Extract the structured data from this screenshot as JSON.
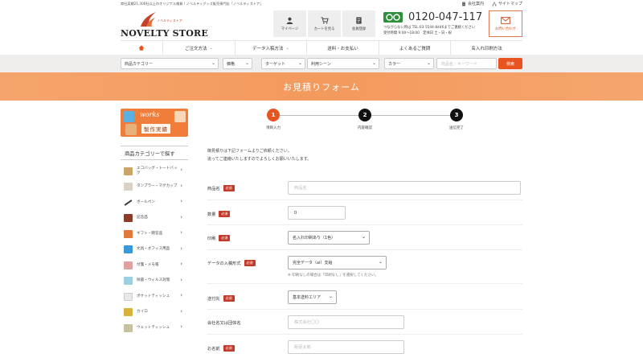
{
  "topbar": {
    "note": "商社実績21,300社以上のオリジナル雑貨 / ノベルティグッズ販売専門店「ノベルティストア」",
    "links": [
      {
        "label": "会社案内",
        "icon": "building-icon"
      },
      {
        "label": "サイトマップ",
        "icon": "sitemap-icon"
      }
    ]
  },
  "logo": {
    "name": "NOVELTY STORE",
    "tagline": "ノベルティストア"
  },
  "header_buttons": [
    {
      "label": "マイページ",
      "icon": "user-icon"
    },
    {
      "label": "カートを見る",
      "icon": "cart-icon"
    },
    {
      "label": "会員登録",
      "icon": "register-icon"
    }
  ],
  "phone": {
    "number": "0120-047-117",
    "sub1": "つながらない時は TEL:03-5544-8446までご連絡ください",
    "sub2": "受付時間 9:00～18:00　定休日 土・日・祝"
  },
  "contact": {
    "label": "お問い合わせ",
    "icon": "mail-icon"
  },
  "nav": [
    {
      "label": "",
      "icon": "home-icon"
    },
    {
      "label": "ご注文方法",
      "chevron": true
    },
    {
      "label": "データ入稿方法",
      "chevron": true
    },
    {
      "label": "送料・お支払い",
      "chevron": false
    },
    {
      "label": "よくあるご質問",
      "chevron": false
    },
    {
      "label": "名入れ印刷方法",
      "chevron": false
    }
  ],
  "filters": {
    "category": "商品カテゴリー",
    "price": "価格",
    "target": "ターゲット",
    "scene": "利用シーン",
    "color": "カラー",
    "keyword_placeholder": "商品名・キーワード",
    "search_label": "検索"
  },
  "banner": {
    "title": "お見積りフォーム"
  },
  "works": {
    "top": "works",
    "bottom": "製作実績"
  },
  "sidebar": {
    "title": "商品カテゴリーで探す",
    "categories": [
      {
        "label": "エコバッグ・トートバッグ",
        "color": "#c9a56a"
      },
      {
        "label": "タンブラー・マグカップ",
        "color": "#d9d2c5"
      },
      {
        "label": "ボールペン",
        "color": "#3a3a3a"
      },
      {
        "label": "記念品",
        "color": "#8a3d2a"
      },
      {
        "label": "ギフト・贈答品",
        "color": "#e07a3a"
      },
      {
        "label": "文具・オフィス用品",
        "color": "#3a9ad9"
      },
      {
        "label": "付箋・メモ帳",
        "color": "#e0a0a0"
      },
      {
        "label": "除菌・ウィルス対策",
        "color": "#9ad0e0"
      },
      {
        "label": "ポケットティッシュ",
        "color": "#e8e8e8"
      },
      {
        "label": "カイロ",
        "color": "#d9b03a"
      },
      {
        "label": "ウェットティッシュ",
        "color": "#c8c0a0"
      }
    ]
  },
  "steps": [
    {
      "num": "1",
      "label": "項目入力",
      "active": true
    },
    {
      "num": "2",
      "label": "内容確認",
      "active": false
    },
    {
      "num": "3",
      "label": "送信完了",
      "active": false
    }
  ],
  "intro": {
    "line1": "御見積りは下記フォームよりご依頼ください。",
    "line2": "追ってご連絡いたしますのでよろしくお願いいたします。"
  },
  "form": {
    "required": "必須",
    "product": {
      "label": "商品名",
      "placeholder": "商品名"
    },
    "quantity": {
      "label": "数量",
      "value": "0"
    },
    "printing": {
      "label": "印刷",
      "value": "名入れ印刷あり（1色）"
    },
    "data_format": {
      "label": "データの入稿形式",
      "value": "完全データ（ai）支給",
      "note": "※ 印刷なしの場合は「印刷なし」を選択してください。"
    },
    "destination": {
      "label": "送付先",
      "value": "基本送料エリア"
    },
    "company": {
      "label": "会社名又は団体名",
      "placeholder": "株式会社〇〇"
    },
    "name": {
      "label": "お名前",
      "placeholder": "販促太郎"
    }
  }
}
